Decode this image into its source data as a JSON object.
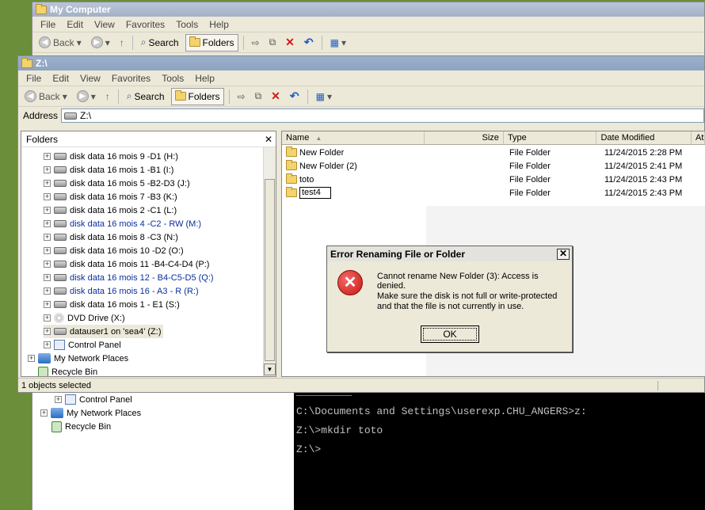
{
  "back_window": {
    "title": "My Computer",
    "menu": [
      "File",
      "Edit",
      "View",
      "Favorites",
      "Tools",
      "Help"
    ],
    "toolbar": {
      "back": "Back",
      "search": "Search",
      "folders": "Folders"
    },
    "tree": [
      {
        "label": "Control Panel",
        "icon": "control-panel-icon"
      },
      {
        "label": "My Network Places",
        "icon": "network-icon"
      },
      {
        "label": "Recycle Bin",
        "icon": "recycle-bin-icon"
      }
    ]
  },
  "cmd": {
    "lines": [
      "C:\\Documents and Settings\\userexp.CHU_ANGERS>z:",
      "Z:\\>mkdir toto",
      "Z:\\>"
    ]
  },
  "front_window": {
    "title": "Z:\\",
    "menu": [
      "File",
      "Edit",
      "View",
      "Favorites",
      "Tools",
      "Help"
    ],
    "toolbar": {
      "back": "Back",
      "search": "Search",
      "folders": "Folders"
    },
    "address": {
      "label": "Address",
      "value": "Z:\\"
    },
    "folders_pane": {
      "title": "Folders",
      "close": "✕",
      "items": [
        {
          "label": "disk data 16 mois 9 -D1 (H:)",
          "blue": false
        },
        {
          "label": "disk data 16 mois 1 -B1 (I:)",
          "blue": false
        },
        {
          "label": "disk data 16 mois 5 -B2-D3 (J:)",
          "blue": false
        },
        {
          "label": "disk data 16 mois 7 -B3 (K:)",
          "blue": false
        },
        {
          "label": "disk data 16 mois 2 -C1 (L:)",
          "blue": false
        },
        {
          "label": "disk data 16 mois 4 -C2 - RW (M:)",
          "blue": true
        },
        {
          "label": "disk data 16 mois 8 -C3 (N:)",
          "blue": false
        },
        {
          "label": "disk data 16 mois 10 -D2 (O:)",
          "blue": false
        },
        {
          "label": "disk data 16 mois 11 -B4-C4-D4 (P:)",
          "blue": false
        },
        {
          "label": "disk data 16 mois 12 - B4-C5-D5 (Q:)",
          "blue": true
        },
        {
          "label": "disk data 16 mois 16 - A3 - R (R:)",
          "blue": true
        },
        {
          "label": "disk data 16 mois 1 - E1 (S:)",
          "blue": false
        },
        {
          "label": "DVD Drive (X:)",
          "blue": false
        },
        {
          "label": "datauser1 on 'sea4' (Z:)",
          "blue": false
        },
        {
          "label": "Control Panel",
          "blue": false
        },
        {
          "label": "My Network Places",
          "blue": false
        },
        {
          "label": "Recycle Bin",
          "blue": false
        }
      ]
    },
    "columns": {
      "name": "Name",
      "size": "Size",
      "type": "Type",
      "date": "Date Modified",
      "attr": "At"
    },
    "files": [
      {
        "name": "New Folder",
        "type": "File Folder",
        "date": "11/24/2015 2:28 PM"
      },
      {
        "name": "New Folder (2)",
        "type": "File Folder",
        "date": "11/24/2015 2:41 PM"
      },
      {
        "name": "toto",
        "type": "File Folder",
        "date": "11/24/2015 2:43 PM"
      },
      {
        "name": "test4",
        "type": "File Folder",
        "date": "11/24/2015 2:43 PM"
      }
    ],
    "status": "1 objects selected"
  },
  "dialog": {
    "title": "Error Renaming File or Folder",
    "close": "✕",
    "message": "Cannot rename New Folder (3): Access is denied.",
    "detail": "Make sure the disk is not full or write-protected and that the file is not currently in use.",
    "ok": "OK"
  }
}
